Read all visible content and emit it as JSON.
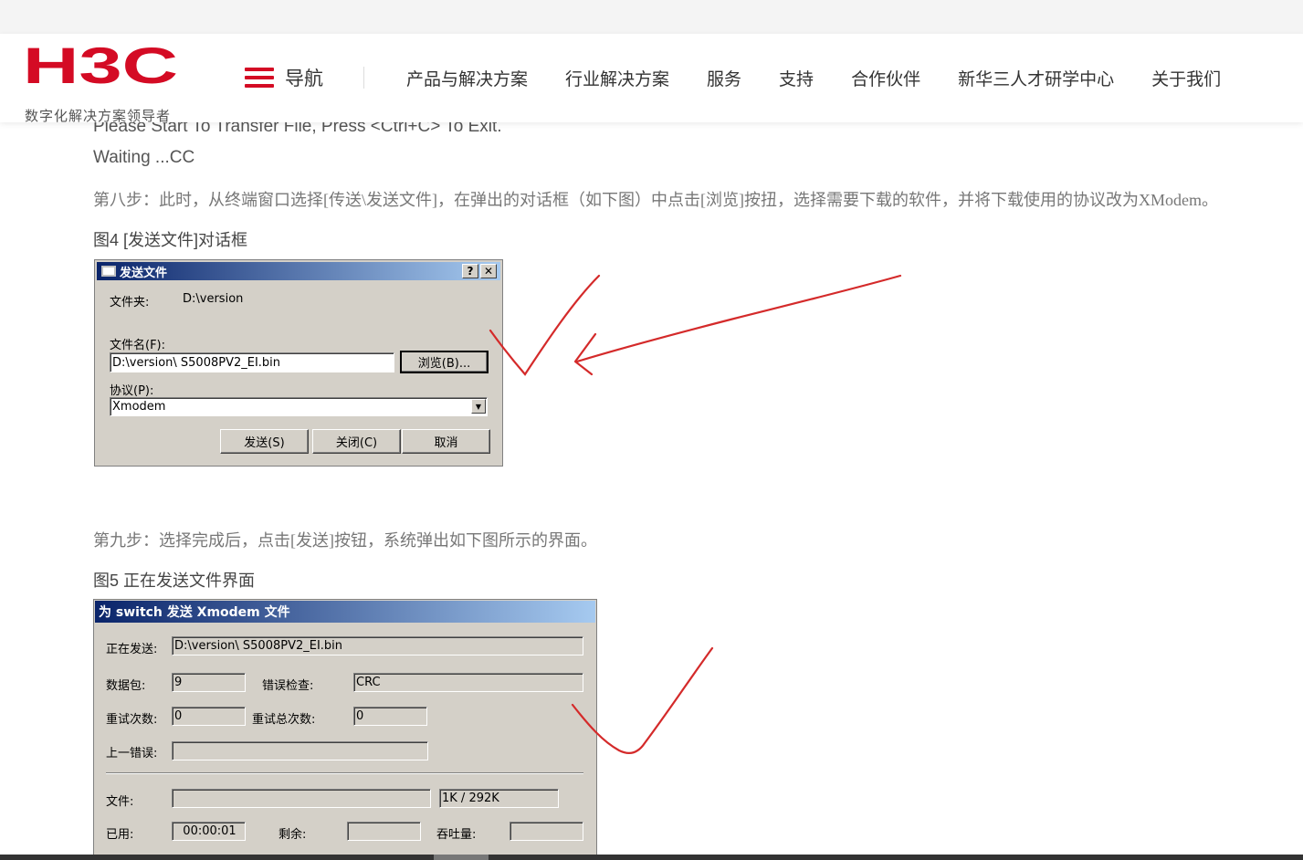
{
  "header": {
    "logo_text": "H3C",
    "logo_tagline": "数字化解决方案领导者",
    "nav_menu_label": "导航",
    "nav_links": [
      "产品与解决方案",
      "行业解决方案",
      "服务",
      "支持",
      "合作伙伴",
      "新华三人才研学中心",
      "关于我们"
    ],
    "brand_color": "#d40b24"
  },
  "article": {
    "console_line_1": "Please Start To Transfer File, Press <Ctrl+C> To Exit.",
    "console_line_2": "Waiting ...CC",
    "step8": "第八步：此时，从终端窗口选择[传送\\发送文件]，在弹出的对话框（如下图）中点击[浏览]按扭，选择需要下载的软件，并将下载使用的协议改为XModem。",
    "figure4_caption": "图4 [发送文件]对话框",
    "step9": "第九步：选择完成后，点击[发送]按钮，系统弹出如下图所示的界面。",
    "figure5_caption": "图5 正在发送文件界面"
  },
  "send_file_dialog": {
    "title": "发送文件",
    "help_btn": "?",
    "close_btn": "✕",
    "folder_label": "文件夹:",
    "folder_value": "D:\\version",
    "filename_label": "文件名(F):",
    "filename_value": "D:\\version\\ S5008PV2_EI.bin",
    "browse_btn": "浏览(B)...",
    "protocol_label": "协议(P):",
    "protocol_value": "Xmodem",
    "send_btn": "发送(S)",
    "close_dialog_btn": "关闭(C)",
    "cancel_btn": "取消"
  },
  "progress_dialog": {
    "title": "为 switch 发送 Xmodem 文件",
    "sending_label": "正在发送:",
    "sending_value": "D:\\version\\ S5008PV2_EI.bin",
    "packets_label": "数据包:",
    "packets_value": "9",
    "error_check_label": "错误检查:",
    "error_check_value": "CRC",
    "retries_label": "重试次数:",
    "retries_value": "0",
    "total_retries_label": "重试总次数:",
    "total_retries_value": "0",
    "last_error_label": "上一错误:",
    "last_error_value": "",
    "file_label": "文件:",
    "file_progress_value": "1K / 292K",
    "elapsed_label": "已用:",
    "elapsed_value": "00:00:01",
    "remaining_label": "剩余:",
    "remaining_value": "",
    "throughput_label": "吞吐量:",
    "throughput_value": ""
  },
  "annotations": {
    "color": "#d42a2a",
    "marks": [
      "checkmark",
      "arrow",
      "checkmark"
    ]
  }
}
